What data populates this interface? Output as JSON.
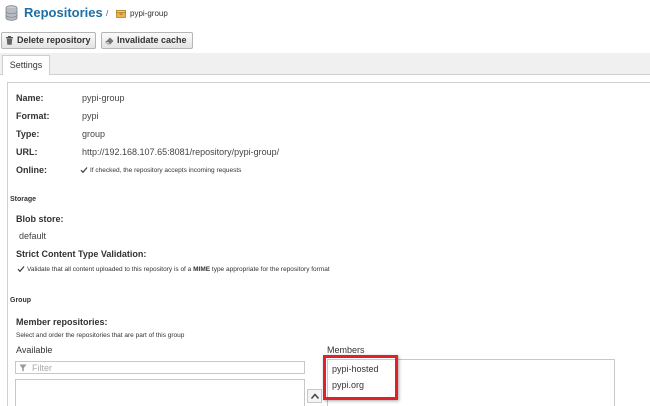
{
  "header": {
    "title": "Repositories",
    "separator": "/",
    "crumb": "pypi-group"
  },
  "toolbar": {
    "delete_label": "Delete repository",
    "invalidate_label": "Invalidate cache"
  },
  "tabs": [
    {
      "label": "Settings"
    }
  ],
  "form": {
    "name_label": "Name:",
    "name_value": "pypi-group",
    "format_label": "Format:",
    "format_value": "pypi",
    "type_label": "Type:",
    "type_value": "group",
    "url_label": "URL:",
    "url_value": "http://192.168.107.65:8081/repository/pypi-group/",
    "online_label": "Online:",
    "online_checked": true,
    "online_help": "If checked, the repository accepts incoming requests"
  },
  "storage": {
    "section_title": "Storage",
    "blob_label": "Blob store:",
    "blob_value": "default",
    "strict_label": "Strict Content Type Validation:",
    "strict_checked": true,
    "strict_help_pre": "Validate that all content uploaded to this repository is of a ",
    "strict_help_mime": "MIME",
    "strict_help_post": " type appropriate for the repository format"
  },
  "group": {
    "section_title": "Group",
    "member_label": "Member repositories:",
    "member_help": "Select and order the repositories that are part of this group",
    "available_label": "Available",
    "members_label": "Members",
    "filter_placeholder": "Filter",
    "available_items": [],
    "members": [
      "pypi-hosted",
      "pypi.org"
    ]
  },
  "colors": {
    "title": "#1d6fa5",
    "highlight_border": "#e0202a"
  }
}
